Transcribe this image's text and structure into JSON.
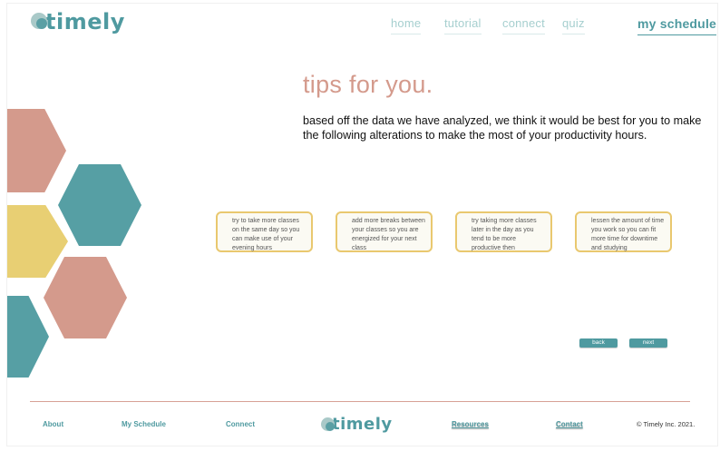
{
  "brand": {
    "name": "timely"
  },
  "nav": {
    "home": "home",
    "tutorial": "tutorial",
    "connect": "connect",
    "quiz": "quiz",
    "my_schedule": "my schedule"
  },
  "main": {
    "title": "tips for you.",
    "intro": "based off the data we have analyzed, we think it would be best for you to make the following alterations to make the most of your productivity hours.",
    "tips": [
      "try to take more classes on the same day so you can make use of your evening hours",
      "add more breaks between your classes so you are energized for your next class",
      "try taking more classes later in the day as you tend to be more productive then",
      "lessen the amount of time you work so you can fit more time for downtime and studying"
    ],
    "back_label": "back",
    "next_label": "next"
  },
  "footer": {
    "about": "About",
    "my_schedule": "My Schedule",
    "connect": "Connect",
    "resources": "Resources",
    "contact": "Contact",
    "copyright": "© Timely Inc. 2021."
  },
  "colors": {
    "teal": "#4f9aa0",
    "pink": "#d49a8c",
    "yellow": "#e8cf73"
  }
}
